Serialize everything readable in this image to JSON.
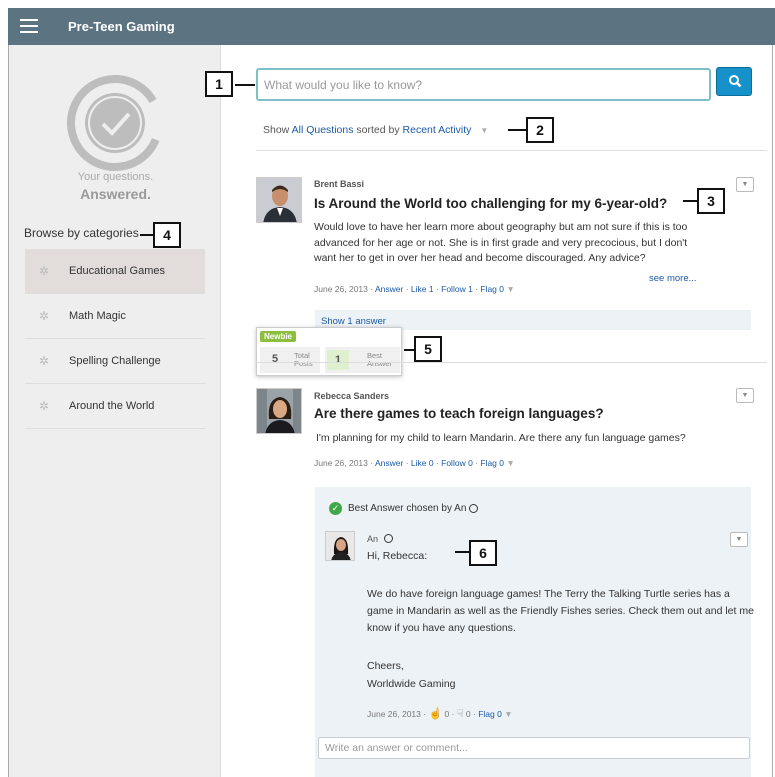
{
  "header": {
    "title": "Pre-Teen Gaming"
  },
  "sidebar": {
    "tagline_top": "Your questions.",
    "tagline_bottom": "Answered.",
    "browse_label": "Browse by categories",
    "categories": [
      {
        "label": "Educational Games",
        "active": true
      },
      {
        "label": "Math Magic",
        "active": false
      },
      {
        "label": "Spelling Challenge",
        "active": false
      },
      {
        "label": "Around the World",
        "active": false
      }
    ]
  },
  "search": {
    "placeholder": "What would you like to know?"
  },
  "filter": {
    "show_label": "Show",
    "show_value": "All Questions",
    "sorted_label": "sorted by",
    "sort_value": "Recent Activity"
  },
  "questions": [
    {
      "author": "Brent Bassi",
      "title": "Is Around the World too challenging for my 6-year-old?",
      "body_lines": [
        "Would love to have her learn more about geography but am not sure if this is too",
        "advanced for her age or not. She is in first grade and very precocious, but I don't",
        "want her to get in over her head and become discouraged. Any advice?"
      ],
      "see_more": "see more...",
      "date": "June 26, 2013",
      "answer_label": "Answer",
      "like_label": "Like 1",
      "follow_label": "Follow 1",
      "flag_label": "Flag 0",
      "show_answers": "Show 1 answer"
    },
    {
      "author": "Rebecca Sanders",
      "title": "Are there games to teach foreign languages?",
      "body_lines": [
        "I'm planning for my child to learn Mandarin. Are there any fun language games?"
      ],
      "date": "June 26, 2013",
      "answer_label": "Answer",
      "like_label": "Like 0",
      "follow_label": "Follow 0",
      "flag_label": "Flag 0"
    }
  ],
  "hover_card": {
    "badge": "Newbie",
    "total_posts": "5",
    "total_label_1": "Total",
    "total_label_2": "Posts",
    "best_count": "1",
    "best_label_1": "Best",
    "best_label_2": "Answer"
  },
  "best_answer": {
    "banner": "Best Answer chosen by An",
    "author": "An",
    "greeting": "Hi, Rebecca:",
    "body_lines": [
      "We do have foreign language games! The Terry the Talking Turtle series has a",
      "game in Mandarin as well as the Friendly Fishes series. Check them out and let me",
      "know if you have any questions."
    ],
    "sign_1": "Cheers,",
    "sign_2": "Worldwide Gaming",
    "date": "June 26, 2013",
    "upvotes": "0",
    "downvotes": "0",
    "flag_label": "Flag 0"
  },
  "comment": {
    "placeholder": "Write an answer or comment..."
  },
  "callouts": [
    "1",
    "2",
    "3",
    "4",
    "5",
    "6"
  ],
  "colors": {
    "header_bg": "#5c7382",
    "accent": "#1791c9",
    "link": "#1b5aa7",
    "badge_green": "#8cbf3f"
  }
}
